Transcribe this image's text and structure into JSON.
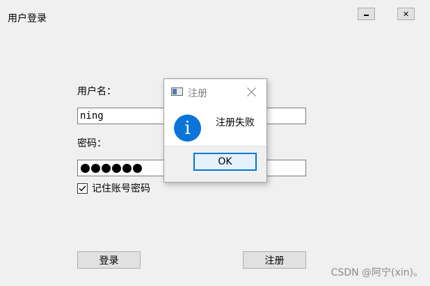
{
  "window": {
    "title": "用户登录",
    "minimize_icon": "minimize-icon",
    "close_label": "✕"
  },
  "form": {
    "username_label": "用户名：",
    "username_value": "ning",
    "password_label": "密码：",
    "password_mask": "●●●●●●",
    "password_length": 6,
    "remember_label": "记住账号密码",
    "remember_checked": true,
    "login_button": "登录",
    "register_button": "注册"
  },
  "dialog": {
    "title": "注册",
    "icon": "info-icon",
    "message": "注册失败",
    "ok_button": "OK",
    "accent_color": "#0078d7"
  },
  "watermark": "CSDN @阿宁(xin)。"
}
